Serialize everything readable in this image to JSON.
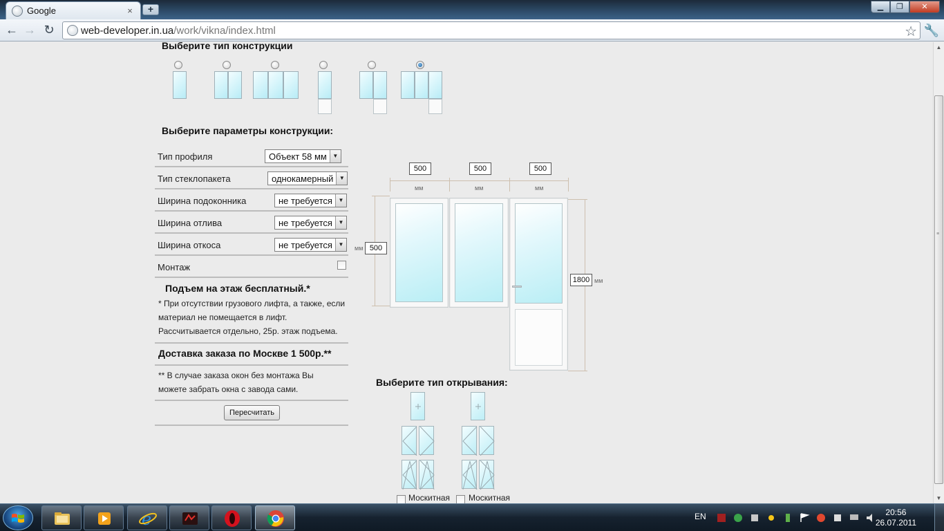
{
  "browser": {
    "tab_title": "Google",
    "tab_close": "×",
    "new_tab": "+",
    "url_host": "web-developer.in.ua",
    "url_path": "/work/vikna/index.html",
    "win_minimize": "▁",
    "win_maximize": "❐",
    "win_close": "✕",
    "back": "←",
    "forward": "→",
    "reload": "↻",
    "star": "☆",
    "wrench": "🔧"
  },
  "page": {
    "construction_heading": "Выберите тип конструкции",
    "params_heading": "Выберите параметры конструкции:",
    "construction_types": [
      {
        "id": "single",
        "selected": false
      },
      {
        "id": "double",
        "selected": false
      },
      {
        "id": "triple",
        "selected": false
      },
      {
        "id": "door",
        "selected": false
      },
      {
        "id": "window-door",
        "selected": false
      },
      {
        "id": "double-window-door",
        "selected": true
      }
    ],
    "params": [
      {
        "label": "Тип профиля",
        "value": "Объект 58 мм"
      },
      {
        "label": "Тип стеклопакета",
        "value": "однокамерный"
      },
      {
        "label": "Ширина подоконника",
        "value": "не требуется"
      },
      {
        "label": "Ширина отлива",
        "value": "не требуется"
      },
      {
        "label": "Ширина откоса",
        "value": "не требуется"
      }
    ],
    "mount_label": "Монтаж",
    "lift_heading": "Подъем на этаж бесплатный.*",
    "lift_notes": [
      "* При отсутствии грузового лифта, а также, если",
      "материал не помещается в лифт.",
      "Рассчитывается отдельно, 25р. этаж подъема."
    ],
    "delivery_heading": "Доставка заказа по Москве 1 500р.**",
    "delivery_notes": [
      "** В случае заказа окон без монтажа Вы",
      "можете забрать окна с завода сами."
    ],
    "recalc_button": "Пересчитать",
    "dimensions": {
      "width_1": "500",
      "width_2": "500",
      "width_3": "500",
      "height_window": "500",
      "height_door": "1800",
      "unit": "мм"
    },
    "opening_heading": "Выберите тип открывания:",
    "mosquito_label_1": "Москитная",
    "mosquito_label_2": "Москитная"
  },
  "taskbar": {
    "lang": "EN",
    "time": "20:56",
    "date": "26.07.2011"
  }
}
